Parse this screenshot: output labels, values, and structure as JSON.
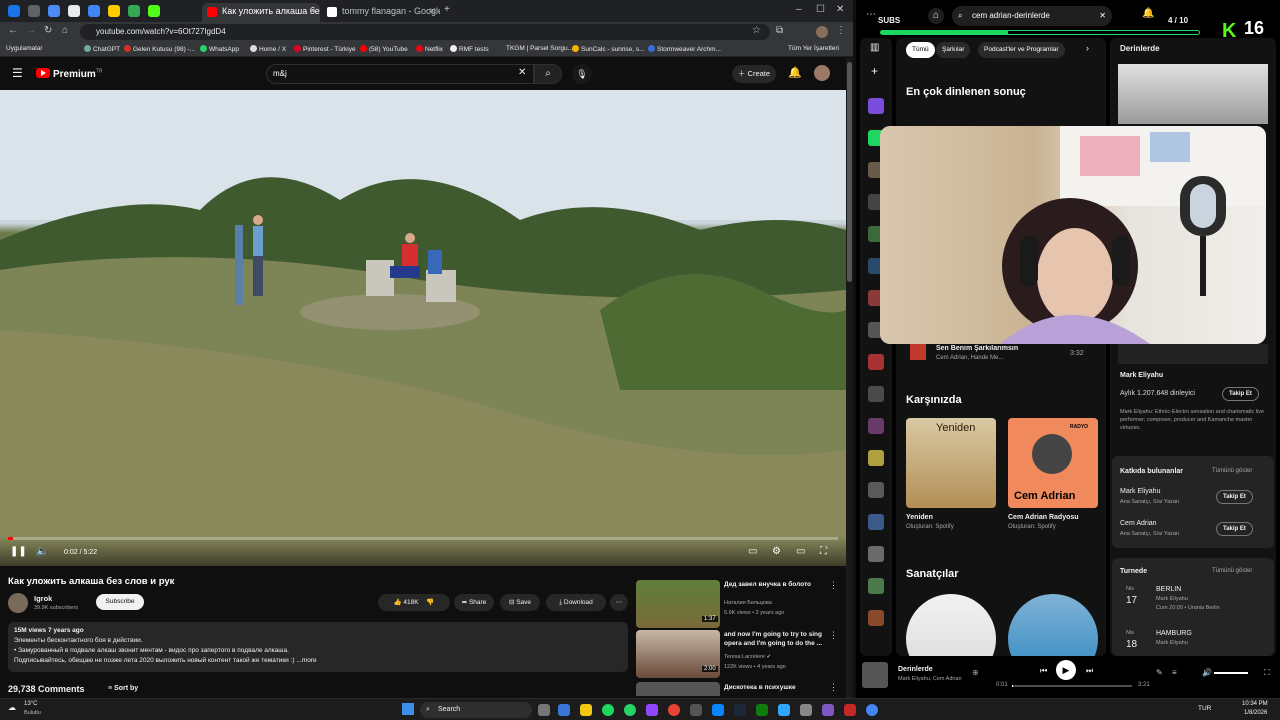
{
  "browser": {
    "tabs": [
      {
        "title": "Как уложить алкаша без с",
        "active": true
      },
      {
        "title": "tommy flanagan - Google'da A",
        "active": false
      }
    ],
    "new_tab": "+",
    "url": "youtube.com/watch?v=6Ot727IgdD4",
    "bookmarks": [
      "Uygulamalar",
      "ChatGPT",
      "Gelen Kutusu (98) -...",
      "WhatsApp",
      "Home / X",
      "Pinterest - Türkiye",
      "(58) YouTube",
      "Netflix",
      "RMF tests",
      "TKGM | Parsel Sorgu...",
      "SunCalc - sunrise, s...",
      "Stormweaver Archm..."
    ],
    "bookmarks_folder": "Tüm Yer İşaretleri"
  },
  "youtube": {
    "logo_text": "Premium",
    "logo_sup": "TR",
    "search_value": "m&j",
    "create_label": "Create",
    "video": {
      "time_current": "0:02",
      "time_total": "5:22",
      "time_display": "0:02 / 5:22",
      "progress": 0.006,
      "title": "Как уложить алкаша без слов и рук"
    },
    "channel": {
      "name": "Igrok",
      "subs": "39.9K subscribers",
      "subscribe_label": "Subscribe"
    },
    "actions": {
      "likes": "418K",
      "share": "Share",
      "save": "Save",
      "download": "Download"
    },
    "description": {
      "meta": "15M views  7 years ago",
      "line1": "Элементы бесконтактного боя в действии.",
      "line2": "• Замурованный в подвале алкаш звонит ментам  - видос про запертого в подвале алкаша.",
      "line3": "Подписывайтесь, обещаю не позже лета 2020 выложить новый контент такой же тематики :) ...more"
    },
    "comments_count": "29,738 Comments",
    "sort_label": "Sort by",
    "recommended": [
      {
        "title": "Дед завел внучка в болото",
        "channel": "Наталия Бельцова",
        "meta": "5.6K views • 2 years ago",
        "duration": "1:37"
      },
      {
        "title": "and now I'm going to try to sing opera and I'm going to do the ...",
        "channel": "Teresa Larzelere ✔",
        "meta": "122K views • 4 years ago",
        "duration": "2:00"
      },
      {
        "title": "Дискотека в психушке",
        "channel": "",
        "meta": "",
        "duration": ""
      }
    ]
  },
  "spotify": {
    "subs_label": "SUBS",
    "subs_count": "4 / 10",
    "k_count": "16",
    "search_value": "cem adrian-derinlerde",
    "chips": [
      "Tümü",
      "Şarkılar",
      "Podcast'ler ve Programlar"
    ],
    "right_title": "Derinlerde",
    "top_result_heading": "En çok dinlenen sonuç",
    "song_row": {
      "title": "Sen Benim Şarkılarımsın",
      "artist": "Cem Adrian, Hande Me...",
      "duration": "3:32"
    },
    "section_karsinizda": "Karşınızda",
    "cards": [
      {
        "name": "Yeniden",
        "sub": "Oluşturan: Spotify",
        "overlay": "Yeniden"
      },
      {
        "name": "Cem Adrian Radyosu",
        "sub": "Oluşturan: Spotify",
        "overlay": "Cem Adrian",
        "badge": "RADYO"
      }
    ],
    "section_artists": "Sanatçılar",
    "artist_panel": {
      "name": "Mark Eliyahu",
      "listeners": "Aylık 1.207.648 dinleyici",
      "follow": "Takip Et",
      "bio": "Mark Eliyahu: Ethnic-Electro sensation and charismatic live performer; composer, producer and Kamanche master virtuoso."
    },
    "contributors": {
      "heading": "Katkıda bulunanlar",
      "show_all": "Tümünü göster",
      "items": [
        {
          "name": "Mark Eliyahu",
          "role": "Ana Sanatçı, Söz Yazarı",
          "follow": "Takip Et"
        },
        {
          "name": "Cem Adrian",
          "role": "Ana Sanatçı, Söz Yazarı",
          "follow": "Takip Et"
        }
      ]
    },
    "tour": {
      "heading": "Turnede",
      "show_all": "Tümünü göster",
      "items": [
        {
          "month": "Nis",
          "day": "17",
          "city": "BERLIN",
          "artist": "Mark Eliyahu",
          "detail": "Cum 20:00 • Urania Berlin"
        },
        {
          "month": "Nis",
          "day": "18",
          "city": "HAMBURG",
          "artist": "Mark Eliyahu",
          "detail": ""
        }
      ]
    },
    "player": {
      "title": "Derinlerde",
      "artist": "Mark Eliyahu, Cem Adrian",
      "elapsed": "0:01",
      "total": "3:21"
    }
  },
  "taskbar": {
    "weather_temp": "13°C",
    "weather_desc": "Bulutlu",
    "search_label": "Search",
    "lang": "TUR",
    "time": "10:34 PM",
    "date": "1/8/2026"
  },
  "colors": {
    "yt_red": "#ff0000",
    "spotify_green": "#1ed760",
    "k_green": "#53fc18"
  }
}
